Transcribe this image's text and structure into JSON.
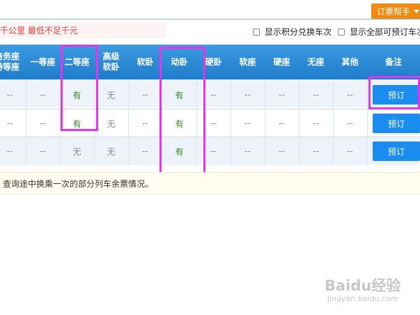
{
  "toolbar": {
    "helper_label": "订票帮手"
  },
  "notice": {
    "text": "千公里 最低不足千元"
  },
  "options": {
    "show_points": "显示积分兑换车次",
    "show_all": "显示全部可预订车次"
  },
  "columns": [
    "商务座\n特等座",
    "一等座",
    "二等座",
    "高级\n软卧",
    "软卧",
    "动卧",
    "硬卧",
    "软座",
    "硬座",
    "无座",
    "其他",
    "备注"
  ],
  "rows": [
    {
      "cells": [
        "--",
        "--",
        "有",
        "无",
        "--",
        "有",
        "--",
        "--",
        "--",
        "--",
        "--"
      ],
      "action": "预订"
    },
    {
      "cells": [
        "--",
        "--",
        "有",
        "无",
        "--",
        "有",
        "--",
        "--",
        "--",
        "--",
        "--"
      ],
      "action": "预订"
    },
    {
      "cells": [
        "--",
        "--",
        "无",
        "无",
        "--",
        "有",
        "--",
        "--",
        "--",
        "--",
        "--"
      ],
      "action": "预订"
    }
  ],
  "footer": {
    "text": "查询途中换乘一次的部分列车余票情况。"
  },
  "watermark": {
    "brand": "Baidu经验",
    "url": "jingyan.baidu.com"
  },
  "colors": {
    "header": "#1f7ccb",
    "accent": "#f28a10",
    "available": "#2a8a1a",
    "highlight": "#e236e8",
    "button": "#1b8cf0"
  }
}
